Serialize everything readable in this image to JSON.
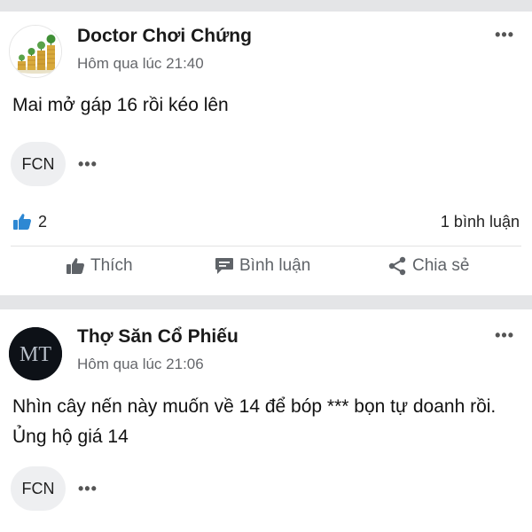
{
  "posts": [
    {
      "author": "Doctor Chơi Chứng",
      "time": "Hôm qua lúc 21:40",
      "more": "•••",
      "content": "Mai mở gáp 16 rồi kéo lên",
      "tag": "FCN",
      "tag_more": "•••",
      "like_count": "2",
      "comment_count": "1 bình luận",
      "actions": {
        "like": "Thích",
        "comment": "Bình luận",
        "share": "Chia sẻ"
      }
    },
    {
      "author": "Thợ Săn Cổ Phiếu",
      "time": "Hôm qua lúc 21:06",
      "more": "•••",
      "content": "Nhìn cây nến này muốn về 14 để bóp *** bọn tự doanh rồi. Ủng hộ giá 14",
      "tag": "FCN",
      "tag_more": "•••",
      "avatar_monogram": "MT"
    }
  ],
  "colors": {
    "like_icon": "#2d88d3",
    "muted_text": "#65676b",
    "separator": "#e4e5e7",
    "action_icon": "#5f6368"
  },
  "icons": {
    "like_count": "thumbs-up-filled-icon",
    "like": "thumbs-up-icon",
    "comment": "comment-bubble-icon",
    "share": "share-nodes-icon"
  }
}
